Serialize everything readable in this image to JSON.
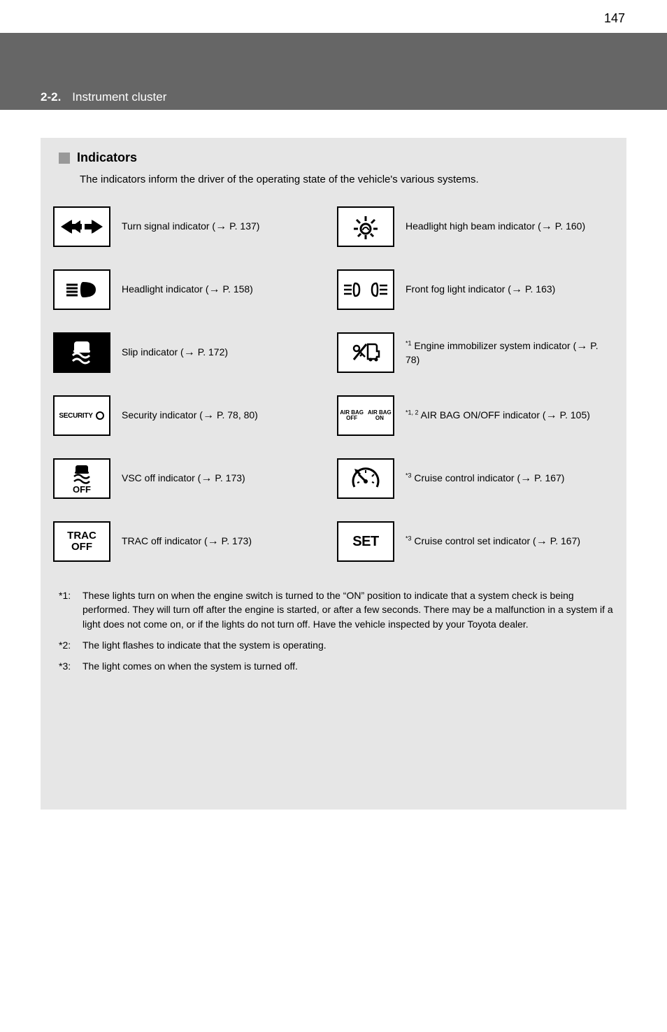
{
  "pageNumber": "147",
  "header": {
    "section": "2-2.",
    "title": "Instrument cluster"
  },
  "box": {
    "subtitle": "Indicators",
    "intro": "The indicators inform the driver of the operating state of the vehicle's various systems."
  },
  "left": [
    {
      "name": "turn-signal-icon",
      "label_html": "Turn signal indicator (<span class='arrow'>→</span>P. 137)"
    },
    {
      "name": "headlight-indicator-icon",
      "label_html": "Headlight indicator (<span class='arrow'>→</span>P. 158)"
    },
    {
      "name": "slip-indicator-icon",
      "label_html": "Slip indicator (<span class='arrow'>→</span>P. 172)"
    },
    {
      "name": "security-indicator-icon",
      "label_html": "Security indicator (<span class='arrow'>→</span>P. 78, 80)"
    },
    {
      "name": "vsc-off-icon",
      "label_html": "VSC off indicator (<span class='arrow'>→</span>P. 173)"
    },
    {
      "name": "trac-off-icon",
      "label_html": "TRAC off indicator (<span class='arrow'>→</span>P. 173)"
    }
  ],
  "right": [
    {
      "name": "high-beam-icon",
      "label_html": "Headlight high beam indicator (<span class='arrow'>→</span>P. 160)"
    },
    {
      "name": "front-fog-light-icon",
      "label_html": "Front fog light indicator (<span class='arrow'>→</span>P. 163)"
    },
    {
      "name": "engine-immobilizer-icon",
      "label_html": "<sup>*1</sup> Engine immobilizer system indicator (<span class='arrow'>→</span>P. 78)"
    },
    {
      "name": "airbag-onoff-icon",
      "label_html": "<sup>*1, 2</sup> AIR BAG ON/OFF indicator (<span class='arrow'>→</span>P. 105)"
    },
    {
      "name": "cruise-control-icon",
      "label_html": "<sup>*3</sup> Cruise control indicator (<span class='arrow'>→</span>P. 167)"
    },
    {
      "name": "cruise-set-icon",
      "label_html": "<sup>*3</sup> Cruise control set indicator (<span class='arrow'>→</span>P. 167)"
    }
  ],
  "footnotes": [
    {
      "star": "*1:",
      "text": "These lights turn on when the engine switch is turned to the “ON” position to indicate that a system check is being performed. They will turn off after the engine is started, or after a few seconds. There may be a malfunction in a system if a light does not come on, or if the lights do not turn off. Have the vehicle inspected by your Toyota dealer."
    },
    {
      "star": "*2:",
      "text": "The light flashes to indicate that the system is operating."
    },
    {
      "star": "*3:",
      "text": "The light comes on when the system is turned off."
    }
  ]
}
